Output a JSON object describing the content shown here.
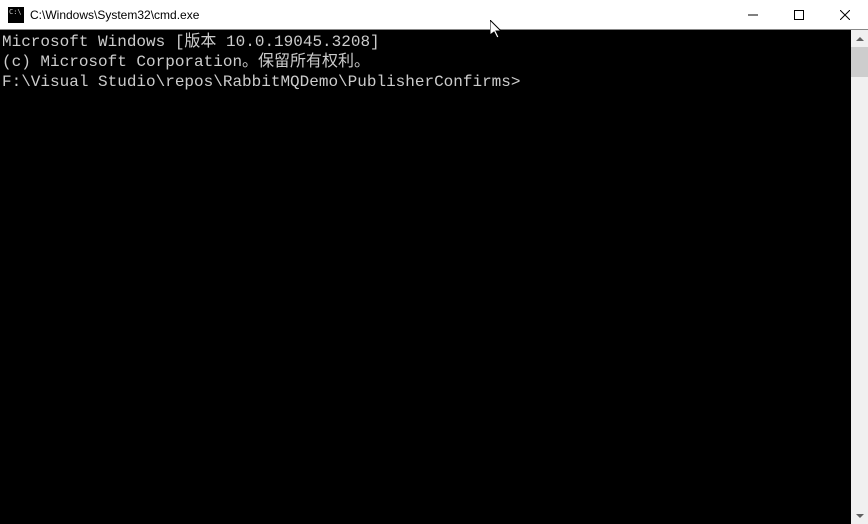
{
  "titlebar": {
    "title": "C:\\Windows\\System32\\cmd.exe"
  },
  "terminal": {
    "line1": "Microsoft Windows [版本 10.0.19045.3208]",
    "line2": "(c) Microsoft Corporation。保留所有权利。",
    "blank1": "",
    "prompt": "F:\\Visual Studio\\repos\\RabbitMQDemo\\PublisherConfirms>"
  }
}
